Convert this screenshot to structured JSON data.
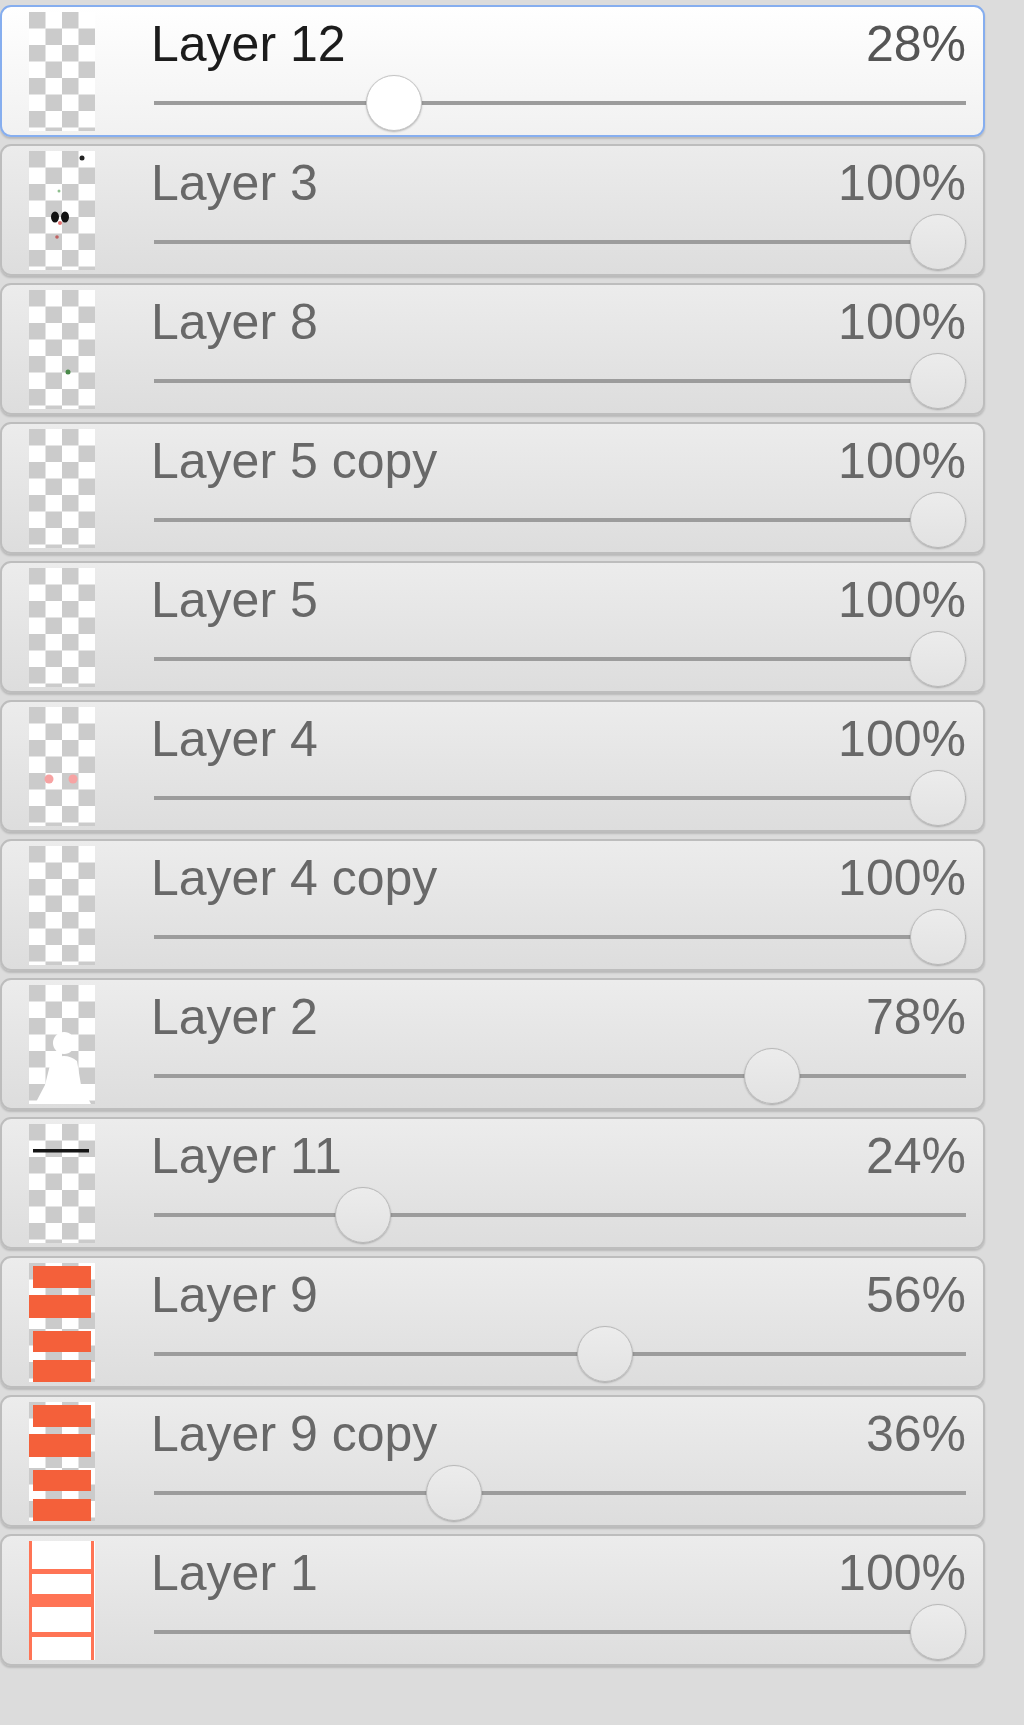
{
  "layers": [
    {
      "name": "Layer 12",
      "opacity": "28%",
      "level": 0.28,
      "selected": true,
      "thumbnail": {
        "kind": "blank"
      }
    },
    {
      "name": "Layer 3",
      "opacity": "100%",
      "level": 1,
      "selected": false,
      "thumbnail": {
        "kind": "face"
      }
    },
    {
      "name": "Layer 8",
      "opacity": "100%",
      "level": 1,
      "selected": false,
      "thumbnail": {
        "kind": "dot"
      }
    },
    {
      "name": "Layer 5 copy",
      "opacity": "100%",
      "level": 1,
      "selected": false,
      "thumbnail": {
        "kind": "blank"
      }
    },
    {
      "name": "Layer 5",
      "opacity": "100%",
      "level": 1,
      "selected": false,
      "thumbnail": {
        "kind": "blank"
      }
    },
    {
      "name": "Layer 4",
      "opacity": "100%",
      "level": 1,
      "selected": false,
      "thumbnail": {
        "kind": "blush"
      }
    },
    {
      "name": "Layer 4 copy",
      "opacity": "100%",
      "level": 1,
      "selected": false,
      "thumbnail": {
        "kind": "blank"
      }
    },
    {
      "name": "Layer 2",
      "opacity": "78%",
      "level": 0.78,
      "selected": false,
      "thumbnail": {
        "kind": "figure"
      }
    },
    {
      "name": "Layer 11",
      "opacity": "24%",
      "level": 0.24,
      "selected": false,
      "thumbnail": {
        "kind": "line"
      }
    },
    {
      "name": "Layer 9",
      "opacity": "56%",
      "level": 0.56,
      "selected": false,
      "thumbnail": {
        "kind": "bars"
      }
    },
    {
      "name": "Layer 9 copy",
      "opacity": "36%",
      "level": 0.36,
      "selected": false,
      "thumbnail": {
        "kind": "bars"
      }
    },
    {
      "name": "Layer 1",
      "opacity": "100%",
      "level": 1,
      "selected": false,
      "thumbnail": {
        "kind": "ladder"
      }
    }
  ]
}
